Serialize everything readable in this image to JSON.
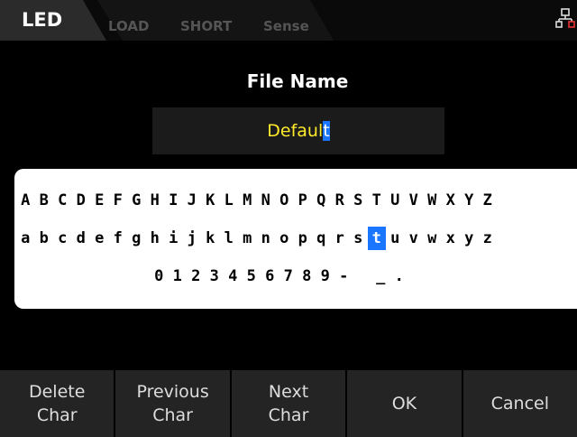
{
  "tabs": {
    "active": "LED",
    "inactive": [
      "LOAD",
      "SHORT",
      "Sense"
    ]
  },
  "status": {
    "icon": "network-icon"
  },
  "file": {
    "title": "File Name",
    "value_before_cursor": "Defaul",
    "cursor_char": "t"
  },
  "keyboard": {
    "rows": [
      [
        "A",
        "B",
        "C",
        "D",
        "E",
        "F",
        "G",
        "H",
        "I",
        "J",
        "K",
        "L",
        "M",
        "N",
        "O",
        "P",
        "Q",
        "R",
        "S",
        "T",
        "U",
        "V",
        "W",
        "X",
        "Y",
        "Z"
      ],
      [
        "a",
        "b",
        "c",
        "d",
        "e",
        "f",
        "g",
        "h",
        "i",
        "j",
        "k",
        "l",
        "m",
        "n",
        "o",
        "p",
        "q",
        "r",
        "s",
        "t",
        "u",
        "v",
        "w",
        "x",
        "y",
        "z"
      ],
      [
        "0",
        "1",
        "2",
        "3",
        "4",
        "5",
        "6",
        "7",
        "8",
        "9",
        "-",
        " ",
        "_",
        "."
      ]
    ],
    "selected": {
      "row": 1,
      "index": 19
    }
  },
  "softkeys": [
    {
      "line1": "Delete",
      "line2": "Char"
    },
    {
      "line1": "Previous",
      "line2": "Char"
    },
    {
      "line1": "Next",
      "line2": "Char"
    },
    {
      "line1": "OK",
      "line2": ""
    },
    {
      "line1": "Cancel",
      "line2": ""
    }
  ],
  "colors": {
    "accent": "#1b76ff",
    "filename_text": "#ffeb2a"
  }
}
